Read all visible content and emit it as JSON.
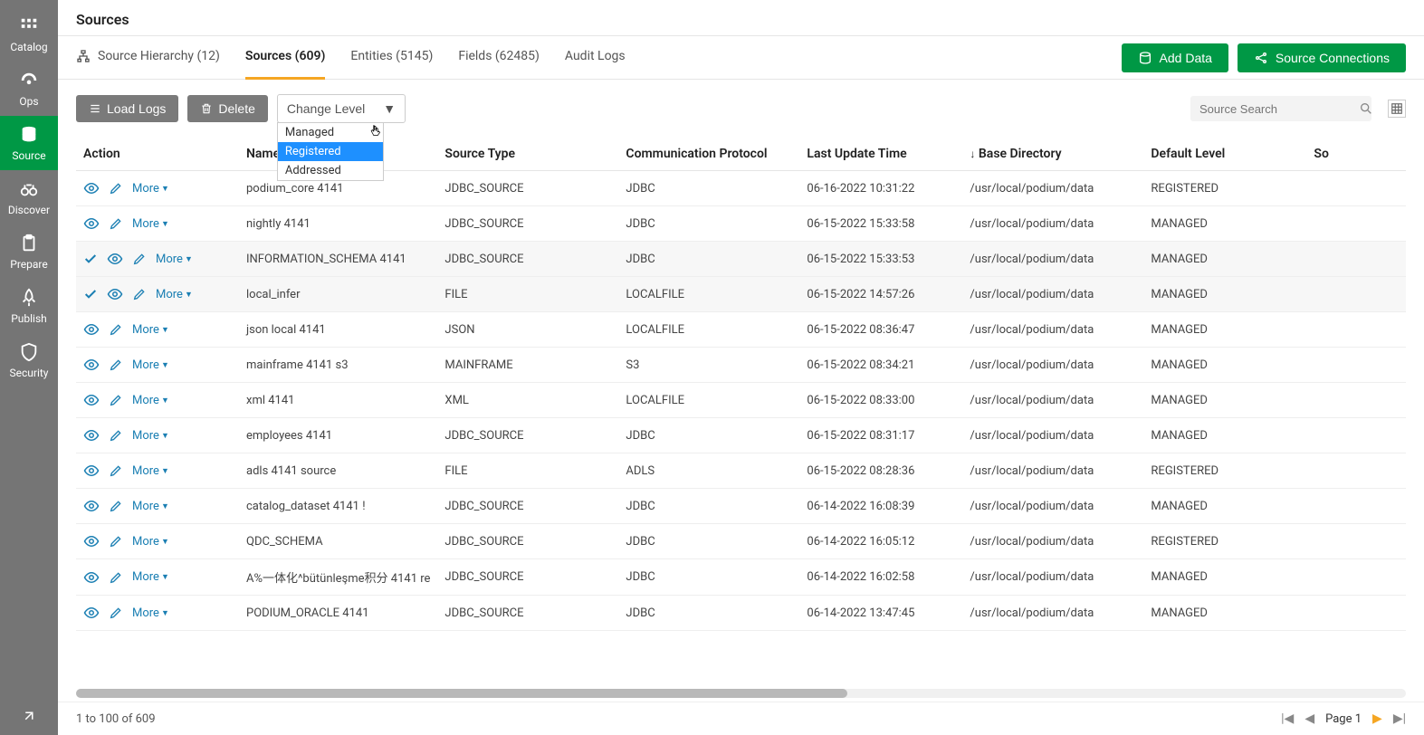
{
  "page_title": "Sources",
  "sidebar": {
    "items": [
      {
        "label": "Catalog",
        "icon": "grid"
      },
      {
        "label": "Ops",
        "icon": "gauge"
      },
      {
        "label": "Source",
        "icon": "database",
        "active": true
      },
      {
        "label": "Discover",
        "icon": "binoculars"
      },
      {
        "label": "Prepare",
        "icon": "clipboard"
      },
      {
        "label": "Publish",
        "icon": "rocket"
      },
      {
        "label": "Security",
        "icon": "shield"
      }
    ]
  },
  "tabs": [
    {
      "label": "Source Hierarchy (12)",
      "icon": "hierarchy"
    },
    {
      "label": "Sources (609)",
      "active": true
    },
    {
      "label": "Entities (5145)"
    },
    {
      "label": "Fields (62485)"
    },
    {
      "label": "Audit Logs"
    }
  ],
  "header_buttons": {
    "add_data": "Add Data",
    "source_connections": "Source Connections"
  },
  "toolbar": {
    "load_logs": "Load Logs",
    "delete": "Delete",
    "change_level": "Change Level",
    "change_level_options": [
      "Managed",
      "Registered",
      "Addressed"
    ],
    "change_level_highlighted": 1,
    "search_placeholder": "Source Search"
  },
  "columns": [
    "Action",
    "Name",
    "Source Type",
    "Communication Protocol",
    "Last Update Time",
    "Base Directory",
    "Default Level",
    "So"
  ],
  "sort_column": "Base Directory",
  "sort_dir": "down",
  "more_label": "More",
  "rows": [
    {
      "selected": false,
      "name": "podium_core 4141",
      "source_type": "JDBC_SOURCE",
      "protocol": "JDBC",
      "last_update": "06-16-2022 10:31:22",
      "base_dir": "/usr/local/podium/data",
      "level": "REGISTERED"
    },
    {
      "selected": false,
      "name": "nightly 4141",
      "source_type": "JDBC_SOURCE",
      "protocol": "JDBC",
      "last_update": "06-15-2022 15:33:58",
      "base_dir": "/usr/local/podium/data",
      "level": "MANAGED"
    },
    {
      "selected": true,
      "name": "INFORMATION_SCHEMA 4141",
      "source_type": "JDBC_SOURCE",
      "protocol": "JDBC",
      "last_update": "06-15-2022 15:33:53",
      "base_dir": "/usr/local/podium/data",
      "level": "MANAGED"
    },
    {
      "selected": true,
      "name": "local_infer",
      "source_type": "FILE",
      "protocol": "LOCALFILE",
      "last_update": "06-15-2022 14:57:26",
      "base_dir": "/usr/local/podium/data",
      "level": "MANAGED"
    },
    {
      "selected": false,
      "name": "json local 4141",
      "source_type": "JSON",
      "protocol": "LOCALFILE",
      "last_update": "06-15-2022 08:36:47",
      "base_dir": "/usr/local/podium/data",
      "level": "MANAGED"
    },
    {
      "selected": false,
      "name": "mainframe 4141 s3",
      "source_type": "MAINFRAME",
      "protocol": "S3",
      "last_update": "06-15-2022 08:34:21",
      "base_dir": "/usr/local/podium/data",
      "level": "MANAGED"
    },
    {
      "selected": false,
      "name": "xml 4141",
      "source_type": "XML",
      "protocol": "LOCALFILE",
      "last_update": "06-15-2022 08:33:00",
      "base_dir": "/usr/local/podium/data",
      "level": "MANAGED"
    },
    {
      "selected": false,
      "name": "employees 4141",
      "source_type": "JDBC_SOURCE",
      "protocol": "JDBC",
      "last_update": "06-15-2022 08:31:17",
      "base_dir": "/usr/local/podium/data",
      "level": "MANAGED"
    },
    {
      "selected": false,
      "name": "adls 4141 source",
      "source_type": "FILE",
      "protocol": "ADLS",
      "last_update": "06-15-2022 08:28:36",
      "base_dir": "/usr/local/podium/data",
      "level": "REGISTERED"
    },
    {
      "selected": false,
      "name": "catalog_dataset 4141 !",
      "source_type": "JDBC_SOURCE",
      "protocol": "JDBC",
      "last_update": "06-14-2022 16:08:39",
      "base_dir": "/usr/local/podium/data",
      "level": "MANAGED"
    },
    {
      "selected": false,
      "name": "QDC_SCHEMA",
      "source_type": "JDBC_SOURCE",
      "protocol": "JDBC",
      "last_update": "06-14-2022 16:05:12",
      "base_dir": "/usr/local/podium/data",
      "level": "REGISTERED"
    },
    {
      "selected": false,
      "name": "A%一体化^bütünleşme积分 4141 re",
      "source_type": "JDBC_SOURCE",
      "protocol": "JDBC",
      "last_update": "06-14-2022 16:02:58",
      "base_dir": "/usr/local/podium/data",
      "level": "MANAGED"
    },
    {
      "selected": false,
      "name": "PODIUM_ORACLE 4141",
      "source_type": "JDBC_SOURCE",
      "protocol": "JDBC",
      "last_update": "06-14-2022 13:47:45",
      "base_dir": "/usr/local/podium/data",
      "level": "MANAGED"
    }
  ],
  "footer": {
    "range": "1 to 100 of 609",
    "page_label": "Page 1"
  }
}
